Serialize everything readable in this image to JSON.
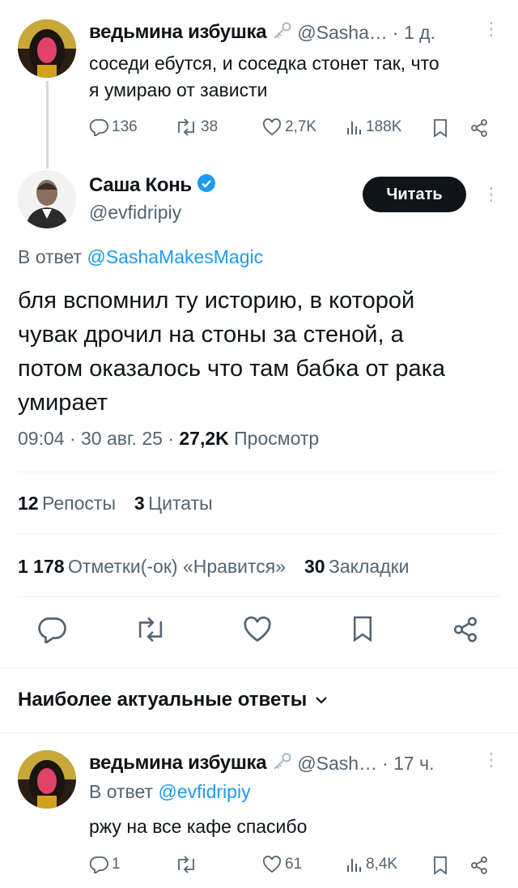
{
  "tweet1": {
    "author_name": "ведьмина избушка",
    "handle": "@Sasha…",
    "time": "· 1 д.",
    "text_line1": "соседи ебутся, и соседка стонет так, что",
    "text_line2": "я умираю от зависти",
    "actions": {
      "replies": "136",
      "reposts": "38",
      "likes": "2,7K",
      "views": "188K"
    }
  },
  "main_tweet": {
    "author_name": "Саша Конь",
    "handle": "@evfidripiy",
    "follow_button": "Читать",
    "reply_to_prefix": "В ответ",
    "reply_to_handle": "@SashaMakesMagic",
    "text_lines": [
      "бля вспомнил ту историю, в которой",
      "чувак дрочил на стоны за стеной, а",
      "потом оказалось что там бабка от рака",
      "умирает"
    ],
    "timestamp": "09:04 · 30 авг. 25 ·",
    "views_count": "27,2K",
    "views_label": "Просмотр",
    "reposts_count": "12",
    "reposts_label": "Репосты",
    "quotes_count": "3",
    "quotes_label": "Цитаты",
    "likes_count": "1 178",
    "likes_label": "Отметки(-ок) «Нравится»",
    "bookmarks_count": "30",
    "bookmarks_label": "Закладки"
  },
  "replies_header": "Наиболее актуальные ответы",
  "reply": {
    "author_name": "ведьмина избушка",
    "handle": "@Sash…",
    "time": "· 17 ч.",
    "reply_to_prefix": "В ответ",
    "reply_to_handle": "@evfidripiy",
    "text": "ржу на все кафе спасибо",
    "actions": {
      "replies": "1",
      "reposts": "",
      "likes": "61",
      "views": "8,4K"
    }
  },
  "colors": {
    "accent": "#1d9bf0",
    "text": "#0f1419",
    "muted": "#536471",
    "divider": "#eff3f4"
  }
}
